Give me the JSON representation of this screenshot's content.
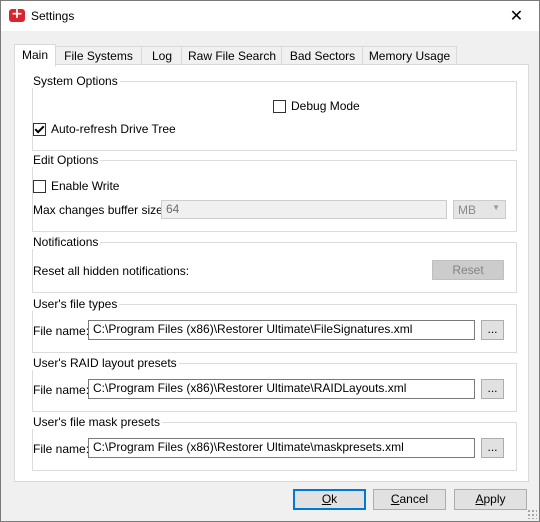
{
  "window": {
    "title": "Settings",
    "close_glyph": "✕"
  },
  "tabs": [
    {
      "label": "Main",
      "active": true
    },
    {
      "label": "File Systems"
    },
    {
      "label": "Log"
    },
    {
      "label": "Raw File Search"
    },
    {
      "label": "Bad Sectors"
    },
    {
      "label": "Memory Usage"
    }
  ],
  "system_options": {
    "title": "System Options",
    "debug_mode": {
      "label": "Debug Mode",
      "checked": false
    },
    "auto_refresh": {
      "label": "Auto-refresh Drive Tree",
      "checked": true
    }
  },
  "edit_options": {
    "title": "Edit Options",
    "enable_write": {
      "label": "Enable Write",
      "checked": false
    },
    "buffer_label": "Max changes buffer size:",
    "buffer_value": "64",
    "buffer_unit": "MB"
  },
  "notifications": {
    "title": "Notifications",
    "reset_label": "Reset all hidden notifications:",
    "reset_button": "Reset"
  },
  "file_types": {
    "title": "User's file types",
    "label": "File name:",
    "value": "C:\\Program Files (x86)\\Restorer Ultimate\\FileSignatures.xml",
    "browse": "..."
  },
  "raid_presets": {
    "title": "User's RAID layout presets",
    "label": "File name:",
    "value": "C:\\Program Files (x86)\\Restorer Ultimate\\RAIDLayouts.xml",
    "browse": "..."
  },
  "mask_presets": {
    "title": "User's file mask presets",
    "label": "File name:",
    "value": "C:\\Program Files (x86)\\Restorer Ultimate\\maskpresets.xml",
    "browse": "..."
  },
  "footer": {
    "ok_first": "O",
    "ok_rest": "k",
    "cancel_first": "C",
    "cancel_rest": "ancel",
    "apply_first": "A",
    "apply_rest": "pply"
  }
}
